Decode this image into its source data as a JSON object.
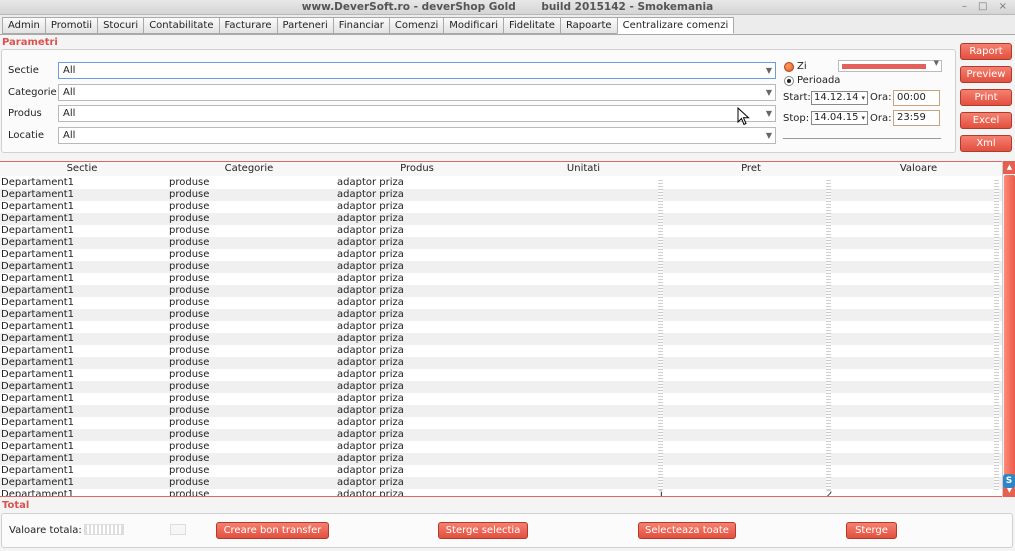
{
  "window": {
    "title": "www.DeverSoft.ro - deverShop Gold       build 2015142 - Smokemania",
    "controls": "– □ ×"
  },
  "tabs": [
    "Admin",
    "Promotii",
    "Stocuri",
    "Contabilitate",
    "Facturare",
    "Parteneri",
    "Financiar",
    "Comenzi",
    "Modificari",
    "Fidelitate",
    "Rapoarte",
    "Centralizare comenzi"
  ],
  "active_tab": "Centralizare comenzi",
  "params": {
    "title": "Parametri",
    "fields": [
      {
        "label": "Sectie",
        "value": "All"
      },
      {
        "label": "Categorie",
        "value": "All"
      },
      {
        "label": "Produs",
        "value": "All"
      },
      {
        "label": "Locatie",
        "value": "All"
      }
    ],
    "period": {
      "zi_label": "Zi",
      "perioada_label": "Perioada",
      "start_label": "Start:",
      "start_date": "14.12.14",
      "stop_label": "Stop:",
      "stop_date": "14.04.15",
      "ora_label": "Ora:",
      "start_time": "00:00",
      "stop_time": "23:59"
    }
  },
  "side_buttons": [
    "Raport",
    "Preview",
    "Print",
    "Excel",
    "Xml"
  ],
  "table": {
    "columns": [
      "Sectie",
      "Categorie",
      "Produs",
      "Unitati",
      "Pret",
      "Valoare"
    ],
    "row": {
      "sectie": "Departament1",
      "categorie": "produse",
      "produs": "adaptor priza"
    },
    "last_row": {
      "unitati": "1",
      "pret": "2"
    }
  },
  "total": {
    "title": "Total",
    "valoare_label": "Valoare totala:",
    "buttons": [
      "Creare bon transfer",
      "Sterge selectia",
      "Selecteaza toate",
      "Sterge"
    ]
  },
  "colors": {
    "accent": "#e2503f",
    "title_red": "#d9534f"
  },
  "icons": [
    "chevron-down-icon",
    "cursor-icon",
    "skype-icon"
  ]
}
